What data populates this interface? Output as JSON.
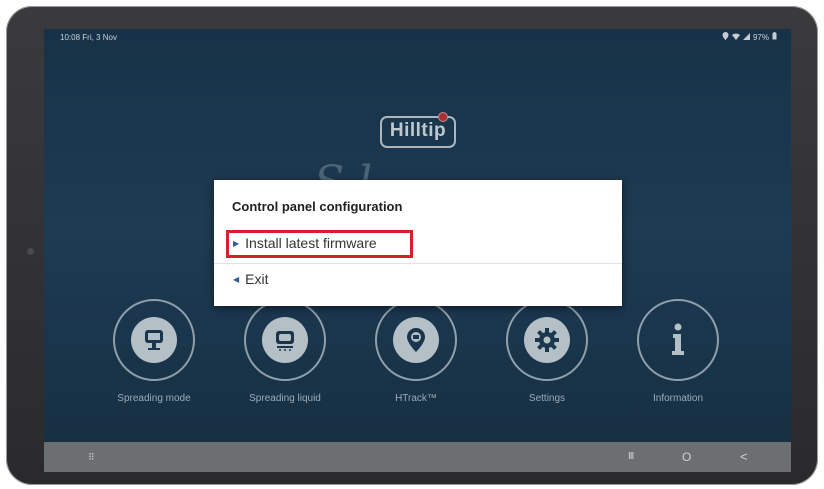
{
  "status": {
    "time": "10:08",
    "date": "Fri, 3 Nov",
    "battery": "97%"
  },
  "logo": {
    "text": "Hilltip"
  },
  "tiles": [
    {
      "label": "Spreading mode",
      "icon": "spreader-icon"
    },
    {
      "label": "Spreading liquid",
      "icon": "liquid-spreader-icon"
    },
    {
      "label": "HTrack™",
      "icon": "location-pin-icon"
    },
    {
      "label": "Settings",
      "icon": "gear-icon"
    },
    {
      "label": "Information",
      "icon": "info-icon"
    }
  ],
  "dialog": {
    "title": "Control panel configuration",
    "items": [
      {
        "label": "Install latest firmware",
        "arrow": "▶"
      },
      {
        "label": "Exit",
        "arrow": "◀"
      }
    ]
  },
  "nav": {
    "apps": "⠿",
    "recents": "III",
    "home": "O",
    "back": "<"
  },
  "colors": {
    "highlight": "#d7202b",
    "screen_bg": "#1e3c55"
  }
}
